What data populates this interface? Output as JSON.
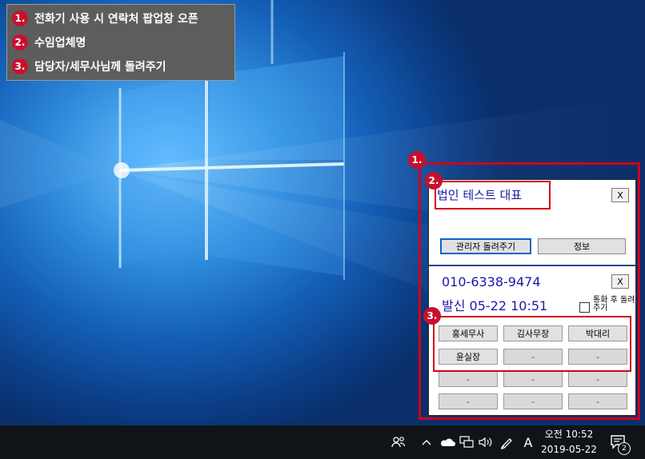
{
  "callout": {
    "items": [
      {
        "num": "1.",
        "text": "전화기 사용 시 연락처 팝업창 오픈"
      },
      {
        "num": "2.",
        "text": "수임업체명"
      },
      {
        "num": "3.",
        "text": "담당자/세무사님께 돌려주기"
      }
    ]
  },
  "badges": {
    "b1": "1.",
    "b2": "2.",
    "b3": "3."
  },
  "popup": {
    "company": "법인  테스트 대표",
    "close_label": "X",
    "transfer_admin_label": "관리자 돌려주기",
    "info_label": "정보",
    "phone": "010-6338-9474",
    "call_info": "발신 05-22 10:51",
    "checkbox_label": "통화 후 돌려주기",
    "staff": [
      {
        "label": "홍세무사"
      },
      {
        "label": "김사무장"
      },
      {
        "label": "박대리"
      },
      {
        "label": "윤실장"
      },
      {
        "label": "-"
      },
      {
        "label": "-"
      },
      {
        "label": "-"
      },
      {
        "label": "-"
      },
      {
        "label": "-"
      },
      {
        "label": "-"
      },
      {
        "label": "-"
      },
      {
        "label": "-"
      }
    ]
  },
  "taskbar": {
    "ime_label": "A",
    "time": "오전 10:52",
    "date": "2019-05-22",
    "notification_count": "2"
  },
  "colors": {
    "accent_red": "#c8102e",
    "popup_text_blue": "#1a1aa8",
    "taskbar_bg": "#101418"
  }
}
